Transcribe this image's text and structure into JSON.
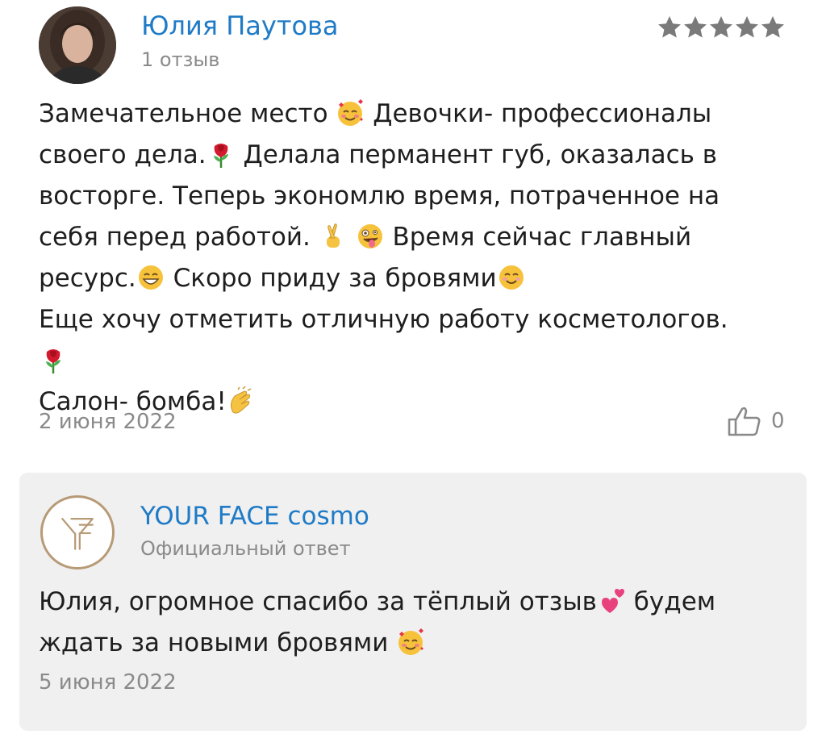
{
  "review": {
    "author_name": "Юлия Паутова",
    "author_meta": "1 отзыв",
    "rating": 5,
    "rating_max": 5,
    "star_color": "#7a7a7a",
    "text_lines": [
      [
        "Замечательное место ",
        "smiling-face-with-hearts-emoji",
        " Девочки- профессионалы"
      ],
      [
        "своего дела.",
        "rose-emoji",
        " Делала перманент губ, оказалась в"
      ],
      [
        "восторге. Теперь экономлю время, потраченное на"
      ],
      [
        "себя перед работой. ",
        "crossed-fingers-emoji",
        " ",
        "zany-face-emoji",
        " Время сейчас главный"
      ],
      [
        "ресурс.",
        "grinning-face-emoji",
        " Скоро приду за бровями",
        "smiling-face-emoji"
      ],
      [
        "Еще хочу отметить отличную работу косметологов."
      ],
      [
        "rose-emoji"
      ],
      [
        "Салон- бомба!",
        "clapping-hands-emoji"
      ]
    ],
    "date": "2 июня 2022",
    "likes": "0"
  },
  "reply": {
    "author_name": "YOUR FACE cosmo",
    "author_meta": "Официальный ответ",
    "logo_icon": "your-face-logo",
    "text_lines": [
      [
        "Юлия, огромное спасибо за тёплый отзыв",
        "two-hearts-emoji",
        " будем"
      ],
      [
        "ждать за новыми бровями ",
        "smiling-face-with-hearts-emoji"
      ]
    ],
    "date": "5 июня 2022"
  },
  "colors": {
    "accent_link": "#1f7bc6",
    "muted_text": "#8a8a8a",
    "reply_background": "#f0f0f0",
    "logo_gold": "#b79a76"
  }
}
